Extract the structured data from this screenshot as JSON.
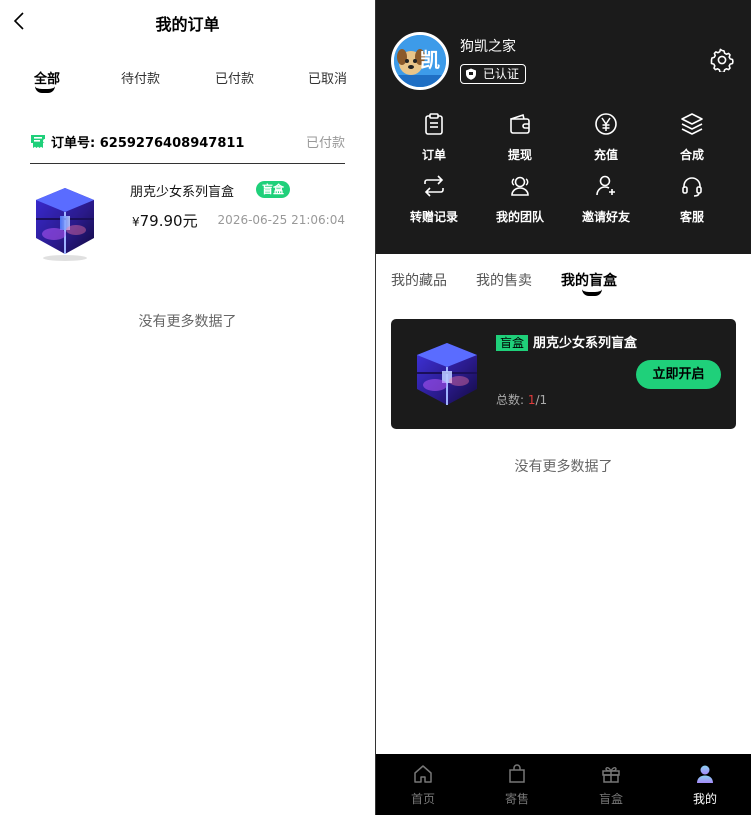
{
  "left": {
    "title": "我的订单",
    "tabs": [
      "全部",
      "待付款",
      "已付款",
      "已取消"
    ],
    "order": {
      "number_label": "订单号:",
      "number": "6259276408947811",
      "status": "已付款",
      "item_name": "朋克少女系列盲盒",
      "badge": "盲盒",
      "currency": "¥",
      "price": "79.90元",
      "time": "2026-06-25 21:06:04"
    },
    "no_more": "没有更多数据了"
  },
  "right": {
    "profile": {
      "username": "狗凯之家",
      "verified_label": "已认证",
      "avatar_text": "凯"
    },
    "grid": [
      {
        "label": "订单",
        "icon": "clipboard-icon"
      },
      {
        "label": "提现",
        "icon": "wallet-icon"
      },
      {
        "label": "充值",
        "icon": "yen-coin-icon"
      },
      {
        "label": "合成",
        "icon": "layers-icon"
      },
      {
        "label": "转赠记录",
        "icon": "transfer-icon"
      },
      {
        "label": "我的团队",
        "icon": "team-icon"
      },
      {
        "label": "邀请好友",
        "icon": "invite-user-icon"
      },
      {
        "label": "客服",
        "icon": "headset-icon"
      }
    ],
    "tabs": [
      "我的藏品",
      "我的售卖",
      "我的盲盒"
    ],
    "card": {
      "badge": "盲盒",
      "name": "朋克少女系列盲盒",
      "count_label": "总数:",
      "count_current": "1",
      "count_total": "/1",
      "open_label": "立即开启"
    },
    "no_more": "没有更多数据了",
    "nav": [
      {
        "label": "首页",
        "icon": "home-icon"
      },
      {
        "label": "寄售",
        "icon": "bag-icon"
      },
      {
        "label": "盲盒",
        "icon": "gift-icon"
      },
      {
        "label": "我的",
        "icon": "user-icon"
      }
    ],
    "accent": "#1fd07a"
  }
}
